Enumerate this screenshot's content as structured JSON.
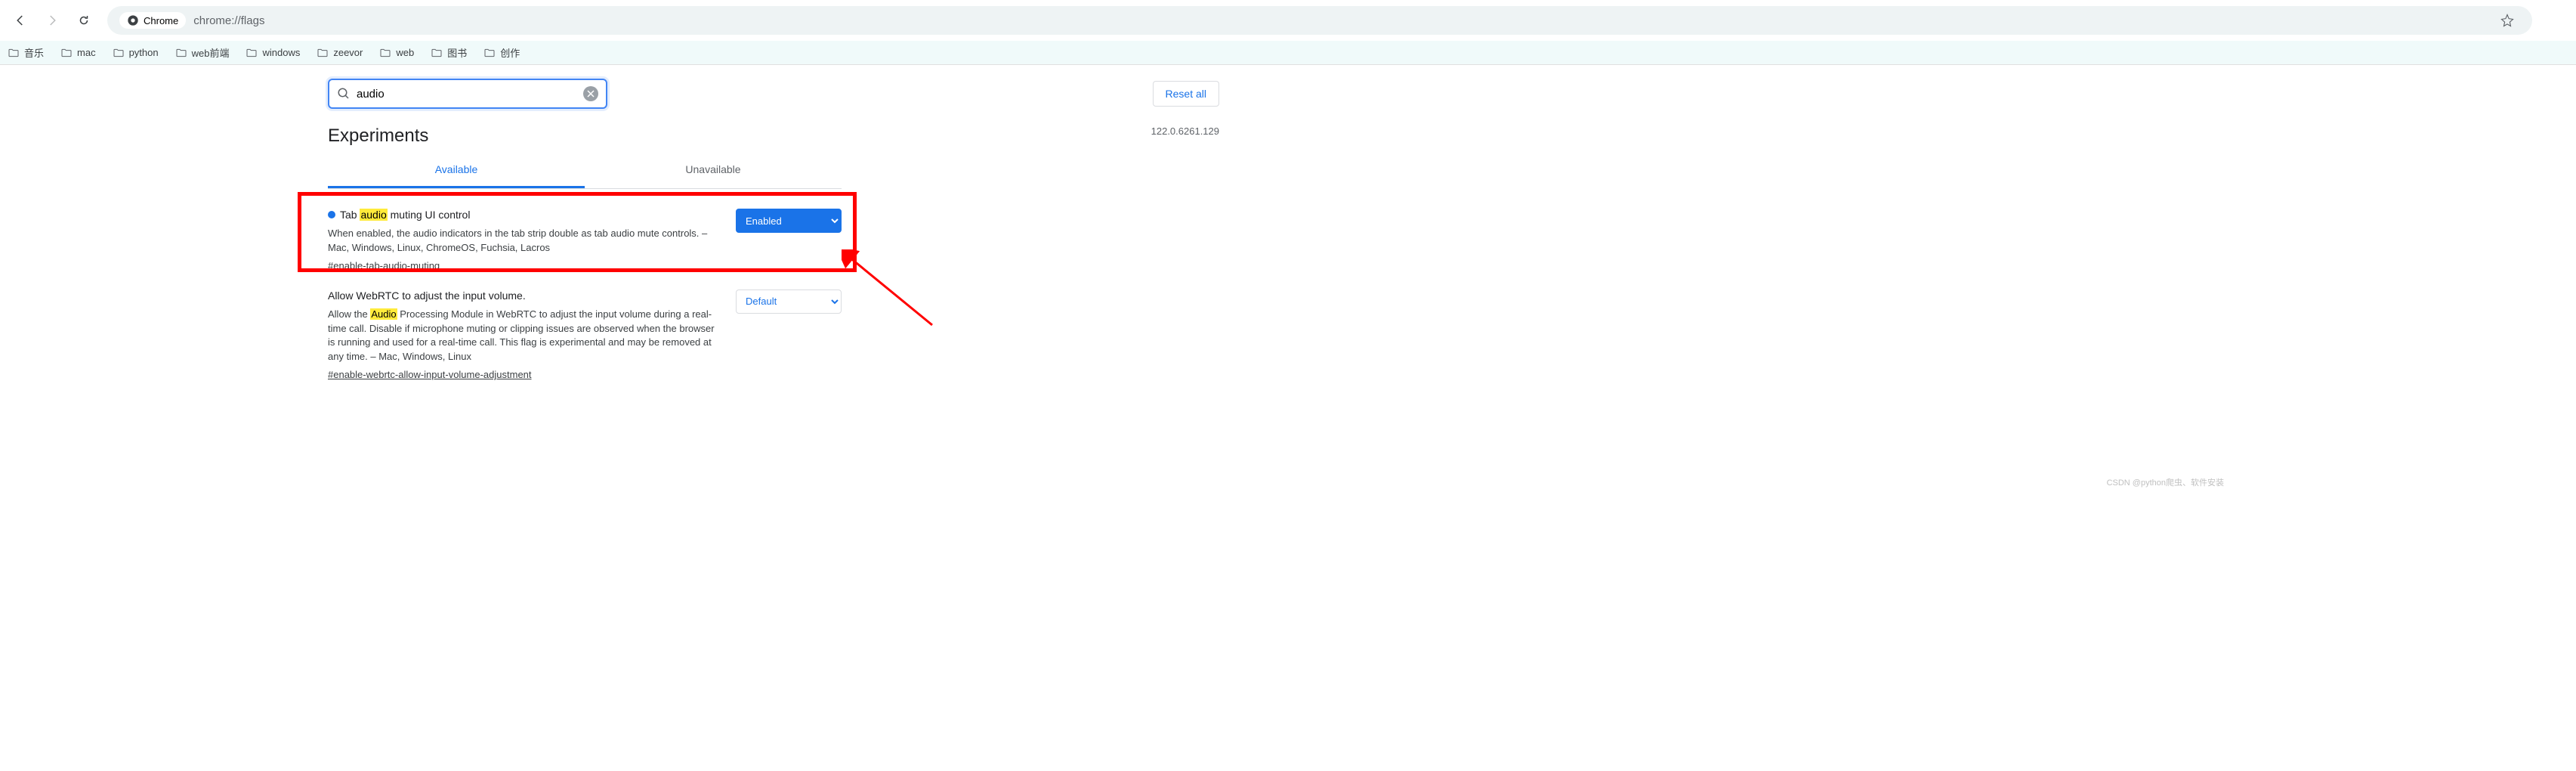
{
  "toolbar": {
    "secure_label": "Chrome",
    "url": "chrome://flags"
  },
  "bookmarks": [
    {
      "label": "音乐"
    },
    {
      "label": "mac"
    },
    {
      "label": "python"
    },
    {
      "label": "web前端"
    },
    {
      "label": "windows"
    },
    {
      "label": "zeevor"
    },
    {
      "label": "web"
    },
    {
      "label": "图书"
    },
    {
      "label": "创作"
    }
  ],
  "search": {
    "value": "audio"
  },
  "reset_label": "Reset all",
  "page_title": "Experiments",
  "version": "122.0.6261.129",
  "tabs": {
    "available": "Available",
    "unavailable": "Unavailable"
  },
  "flags": [
    {
      "title_pre": "Tab ",
      "title_hl": "audio",
      "title_post": " muting UI control",
      "desc": "When enabled, the audio indicators in the tab strip double as tab audio mute controls. – Mac, Windows, Linux, ChromeOS, Fuchsia, Lacros",
      "anchor": "#enable-tab-audio-muting",
      "selected": "Enabled",
      "has_dot": true
    },
    {
      "title_pre": "Allow WebRTC to adjust the input volume.",
      "title_hl": "",
      "title_post": "",
      "desc_pre": "Allow the ",
      "desc_hl": "Audio",
      "desc_post": " Processing Module in WebRTC to adjust the input volume during a real-time call. Disable if microphone muting or clipping issues are observed when the browser is running and used for a real-time call. This flag is experimental and may be removed at any time. – Mac, Windows, Linux",
      "anchor": "#enable-webrtc-allow-input-volume-adjustment",
      "selected": "Default",
      "has_dot": false
    }
  ],
  "watermark": "CSDN @python爬虫、软件安装"
}
